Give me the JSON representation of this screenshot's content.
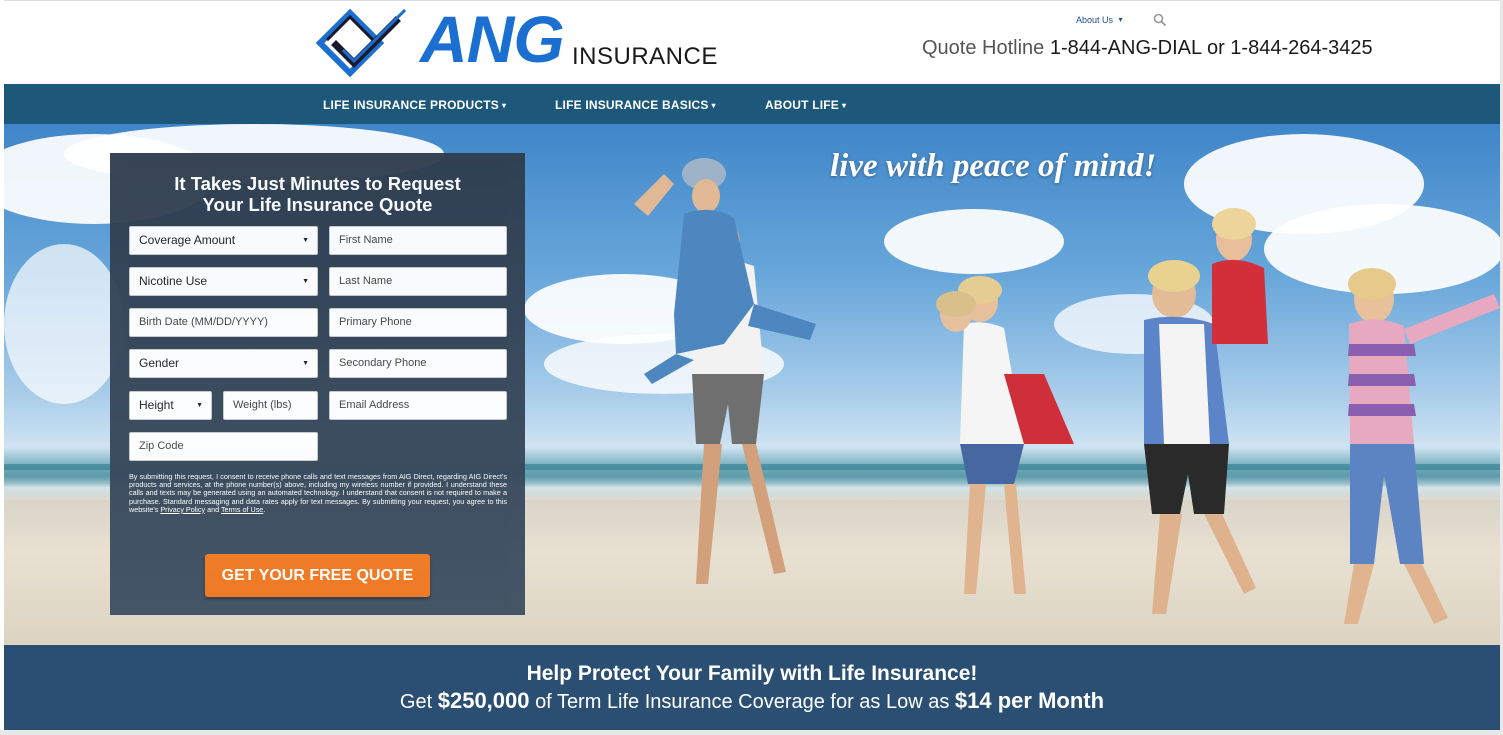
{
  "header": {
    "logo_text": "ANG",
    "logo_subtext": "INSURANCE",
    "about_link": "About Us",
    "hotline_label": "Quote Hotline",
    "hotline_numbers": "1-844-ANG-DIAL or 1-844-264-3425",
    "brand_color": "#1a6fd0"
  },
  "nav": {
    "items": [
      {
        "label": "LIFE INSURANCE PRODUCTS"
      },
      {
        "label": "LIFE INSURANCE BASICS"
      },
      {
        "label": "ABOUT LIFE"
      }
    ],
    "background": "#1d5779"
  },
  "hero": {
    "tagline": "live with peace of mind!"
  },
  "form": {
    "title_line1": "It Takes Just Minutes to Request",
    "title_line2": "Your Life Insurance Quote",
    "coverage_amount": "Coverage Amount",
    "nicotine_use": "Nicotine Use",
    "birth_date_placeholder": "Birth Date (MM/DD/YYYY)",
    "gender": "Gender",
    "height": "Height",
    "weight_placeholder": "Weight (lbs)",
    "zip_placeholder": "Zip Code",
    "first_name_placeholder": "First Name",
    "last_name_placeholder": "Last Name",
    "primary_phone_placeholder": "Primary Phone",
    "secondary_phone_placeholder": "Secondary Phone",
    "email_placeholder": "Email Address",
    "disclaimer": "By submitting this request, I consent to receive phone calls and text messages from AIG Direct, regarding AIG Direct's products and services, at the phone number(s) above, including my wireless number if provided. I understand these calls and texts may be generated using an automated technology. I understand that consent is not required to make a purchase. Standard messaging and data rates apply for text messages. By submitting your request, you agree to this website's",
    "privacy_link": "Privacy Policy",
    "and_text": "and",
    "terms_link": "Terms of Use",
    "cta_label": "GET YOUR FREE QUOTE",
    "cta_color": "#f07820"
  },
  "banner": {
    "headline": "Help Protect Your Family with Life Insurance!",
    "sub_prefix": "Get",
    "amount": "$250,000",
    "sub_middle": "of Term Life Insurance Coverage for as Low as",
    "price": "$14 per Month",
    "background": "#2a4f72"
  }
}
